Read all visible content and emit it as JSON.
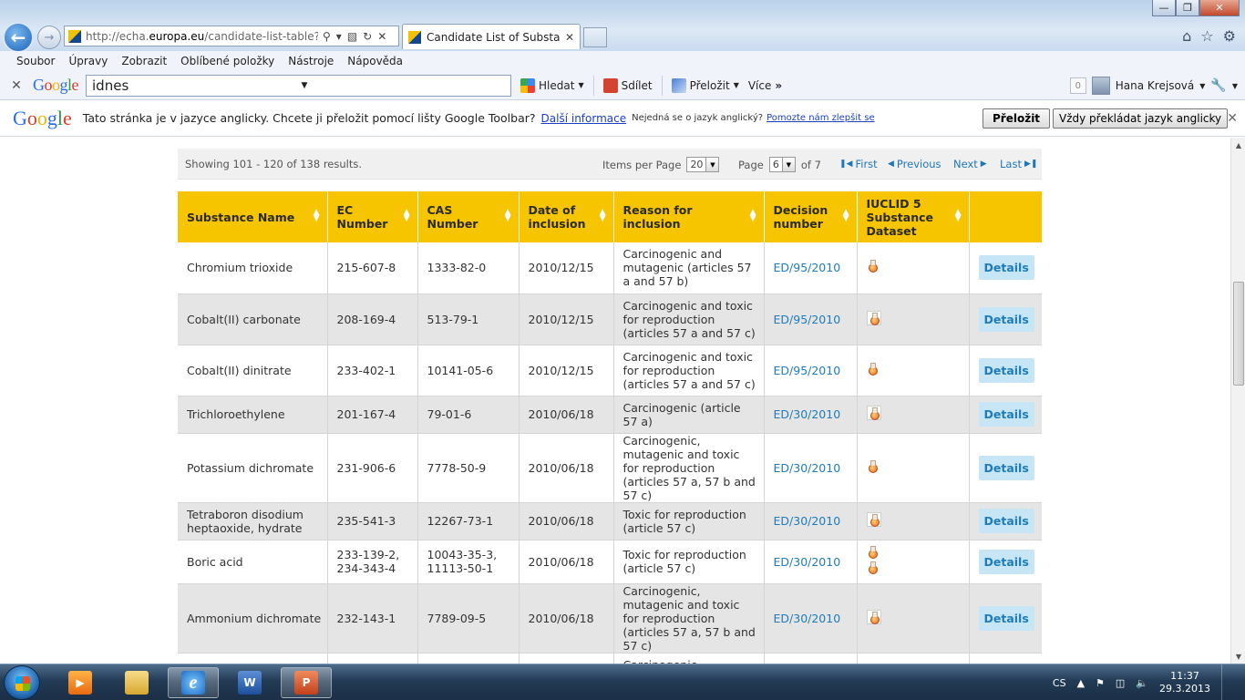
{
  "browser": {
    "url_prefix": "http://echa.",
    "url_domain": "europa.eu",
    "url_suffix": "/candidate-list-table?p_p_",
    "tab_title": "Candidate List of Substance...",
    "menu": [
      "Soubor",
      "Úpravy",
      "Zobrazit",
      "Oblíbené položky",
      "Nástroje",
      "Nápověda"
    ]
  },
  "google_toolbar": {
    "search_value": "idnes",
    "search_label": "Hledat",
    "share_label": "Sdílet",
    "translate_label": "Přeložit",
    "more_label": "Více",
    "badge_count": "0",
    "user_name": "Hana Krejsová"
  },
  "translate_bar": {
    "message": "Tato stránka je v jazyce anglicky. Chcete ji přeložit pomocí lišty Google Toolbar?",
    "more_info_link": "Další informace",
    "not_english": "Nejedná se o jazyk anglický?",
    "help_link": "Pomozte nám zlepšit se",
    "translate_button": "Přeložit",
    "always_button": "Vždy překládat jazyk anglicky"
  },
  "results": {
    "showing": "Showing 101 - 120 of 138 results.",
    "items_per_page_label": "Items per Page",
    "items_per_page_value": "20",
    "page_label": "Page",
    "page_value": "6",
    "page_of": "of 7",
    "first": "First",
    "previous": "Previous",
    "next": "Next",
    "last": "Last"
  },
  "table": {
    "headers": {
      "substance_name": "Substance Name",
      "ec_number": "EC Number",
      "cas_number": "CAS Number",
      "date_of_inclusion": "Date of inclusion",
      "reason": "Reason for inclusion",
      "decision_number": "Decision number",
      "iuclid": "IUCLID 5 Substance Dataset"
    },
    "details_label": "Details",
    "rows": [
      {
        "name": "Chromium trioxide",
        "ec": "215-607-8",
        "cas": "1333-82-0",
        "date": "2010/12/15",
        "reason": "Carcinogenic and mutagenic (articles 57 a and 57 b)",
        "decision": "ED/95/2010"
      },
      {
        "name": "Cobalt(II) carbonate",
        "ec": "208-169-4",
        "cas": "513-79-1",
        "date": "2010/12/15",
        "reason": "Carcinogenic and toxic for reproduction (articles 57 a and 57 c)",
        "decision": "ED/95/2010"
      },
      {
        "name": "Cobalt(II) dinitrate",
        "ec": "233-402-1",
        "cas": "10141-05-6",
        "date": "2010/12/15",
        "reason": "Carcinogenic and toxic for reproduction (articles 57 a and 57 c)",
        "decision": "ED/95/2010"
      },
      {
        "name": "Trichloroethylene",
        "ec": "201-167-4",
        "cas": "79-01-6",
        "date": "2010/06/18",
        "reason": "Carcinogenic (article 57 a)",
        "decision": "ED/30/2010"
      },
      {
        "name": "Potassium dichromate",
        "ec": "231-906-6",
        "cas": "7778-50-9",
        "date": "2010/06/18",
        "reason": "Carcinogenic, mutagenic and toxic for reproduction (articles 57 a, 57 b and 57 c)",
        "decision": "ED/30/2010"
      },
      {
        "name": "Tetraboron disodium heptaoxide, hydrate",
        "ec": "235-541-3",
        "cas": "12267-73-1",
        "date": "2010/06/18",
        "reason": "Toxic for reproduction (article 57 c)",
        "decision": "ED/30/2010"
      },
      {
        "name": "Boric acid",
        "ec": "233-139-2, 234-343-4",
        "cas": "10043-35-3, 11113-50-1",
        "date": "2010/06/18",
        "reason": "Toxic for reproduction (article 57 c)",
        "decision": "ED/30/2010"
      },
      {
        "name": "Ammonium dichromate",
        "ec": "232-143-1",
        "cas": "7789-09-5",
        "date": "2010/06/18",
        "reason": "Carcinogenic, mutagenic and toxic for reproduction (articles 57 a, 57 b and 57 c)",
        "decision": "ED/30/2010"
      },
      {
        "name": "",
        "ec": "",
        "cas": "",
        "date": "",
        "reason": "Carcinogenic,",
        "decision": ""
      }
    ]
  },
  "taskbar": {
    "lang": "CS",
    "time": "11:37",
    "date": "29.3.2013"
  }
}
